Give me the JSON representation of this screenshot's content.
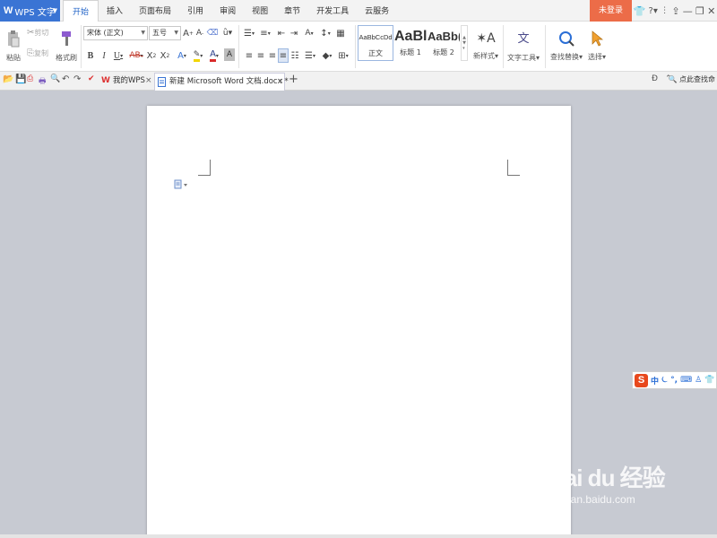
{
  "app": {
    "name": "WPS 文字"
  },
  "menu": {
    "tabs": [
      {
        "label": "开始",
        "active": true
      },
      {
        "label": "插入"
      },
      {
        "label": "页面布局"
      },
      {
        "label": "引用"
      },
      {
        "label": "审阅"
      },
      {
        "label": "视图"
      },
      {
        "label": "章节"
      },
      {
        "label": "开发工具"
      },
      {
        "label": "云服务"
      }
    ],
    "login_label": "未登录"
  },
  "ribbon": {
    "clipboard": {
      "paste": "粘贴",
      "cut": "剪切",
      "copy": "复制",
      "format_painter": "格式刷"
    },
    "font": {
      "family": "宋体 (正文)",
      "size": "五号"
    },
    "styles": [
      {
        "sample": "AaBbCcDd",
        "name": "正文"
      },
      {
        "sample": "AaBl",
        "name": "标题 1"
      },
      {
        "sample": "AaBb(",
        "name": "标题 2"
      }
    ],
    "new_style": "新样式",
    "text_tools": "文字工具",
    "find_replace": "查找替换",
    "select": "选择"
  },
  "doc_tabs": [
    {
      "label": "我的WPS"
    },
    {
      "label": "新建 Microsoft Word 文档.docx *",
      "active": true
    }
  ],
  "search_help": "点此查找命",
  "ime": {
    "logo": "S",
    "items": [
      "中",
      "⏾",
      "°,",
      "⌨",
      "♙",
      "👕"
    ]
  },
  "watermark": {
    "main": "Bai du 经验",
    "sub": "jingyan.baidu.com"
  },
  "colors": {
    "accent": "#3a74d4",
    "login": "#ec6c48",
    "font_color_red": "#d92b2b",
    "highlight_yellow": "#f2d600"
  }
}
